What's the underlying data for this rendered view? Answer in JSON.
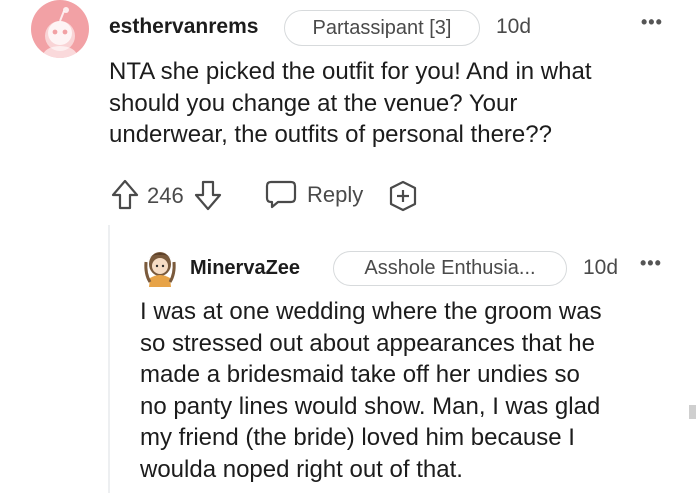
{
  "comment": {
    "username": "esthervanrems",
    "flair": "Partassipant [3]",
    "timestamp": "10d",
    "more_label": "•••",
    "lines": [
      "NTA she picked the outfit for you! And in what",
      "should you change at the venue? Your",
      "underwear, the outfits of personal there??"
    ],
    "vote_count": "246",
    "reply_label": "Reply",
    "icons": {
      "upvote": "upvote-arrow-icon",
      "downvote": "downvote-arrow-icon",
      "reply": "speech-bubble-icon",
      "award": "plus-award-icon"
    }
  },
  "reply": {
    "username": "MinervaZee",
    "flair": "Asshole Enthusia...",
    "timestamp": "10d",
    "more_label": "•••",
    "lines": [
      "I was at one wedding where the groom was",
      "so stressed out about appearances that he",
      "made a bridesmaid take off her undies so",
      "no panty lines would show. Man, I was glad",
      "my friend (the bride) loved him because I",
      "woulda noped right out of that."
    ]
  },
  "colors": {
    "avatar_bg": "#f2a1a5",
    "text": "#1c1c1c",
    "meta": "#4a4a4a",
    "border": "#d7dadc"
  }
}
